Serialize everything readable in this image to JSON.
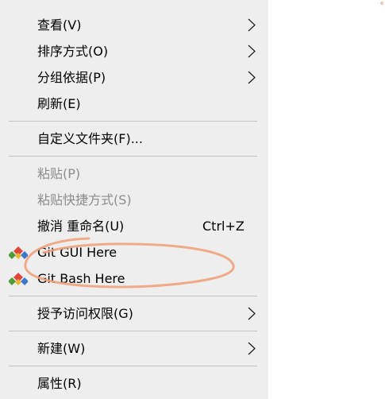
{
  "menu": {
    "items": [
      {
        "label": "查看(V)",
        "submenu": true
      },
      {
        "label": "排序方式(O)",
        "submenu": true
      },
      {
        "label": "分组依据(P)",
        "submenu": true
      },
      {
        "label": "刷新(E)"
      },
      {
        "label": "自定义文件夹(F)..."
      },
      {
        "label": "粘贴(P)",
        "disabled": true
      },
      {
        "label": "粘贴快捷方式(S)",
        "disabled": true
      },
      {
        "label": "撤消 重命名(U)",
        "shortcut": "Ctrl+Z"
      },
      {
        "label": "Git GUI Here",
        "icon": "git-gui-icon"
      },
      {
        "label": "Git Bash Here",
        "icon": "git-bash-icon"
      },
      {
        "label": "授予访问权限(G)",
        "submenu": true
      },
      {
        "label": "新建(W)",
        "submenu": true
      },
      {
        "label": "属性(R)"
      }
    ]
  },
  "colors": {
    "menu_bg": "#eeeeee",
    "text": "#000000",
    "disabled_text": "#8c8c8c",
    "separator": "#c4c4c4",
    "annotation": "#f0a27c"
  }
}
